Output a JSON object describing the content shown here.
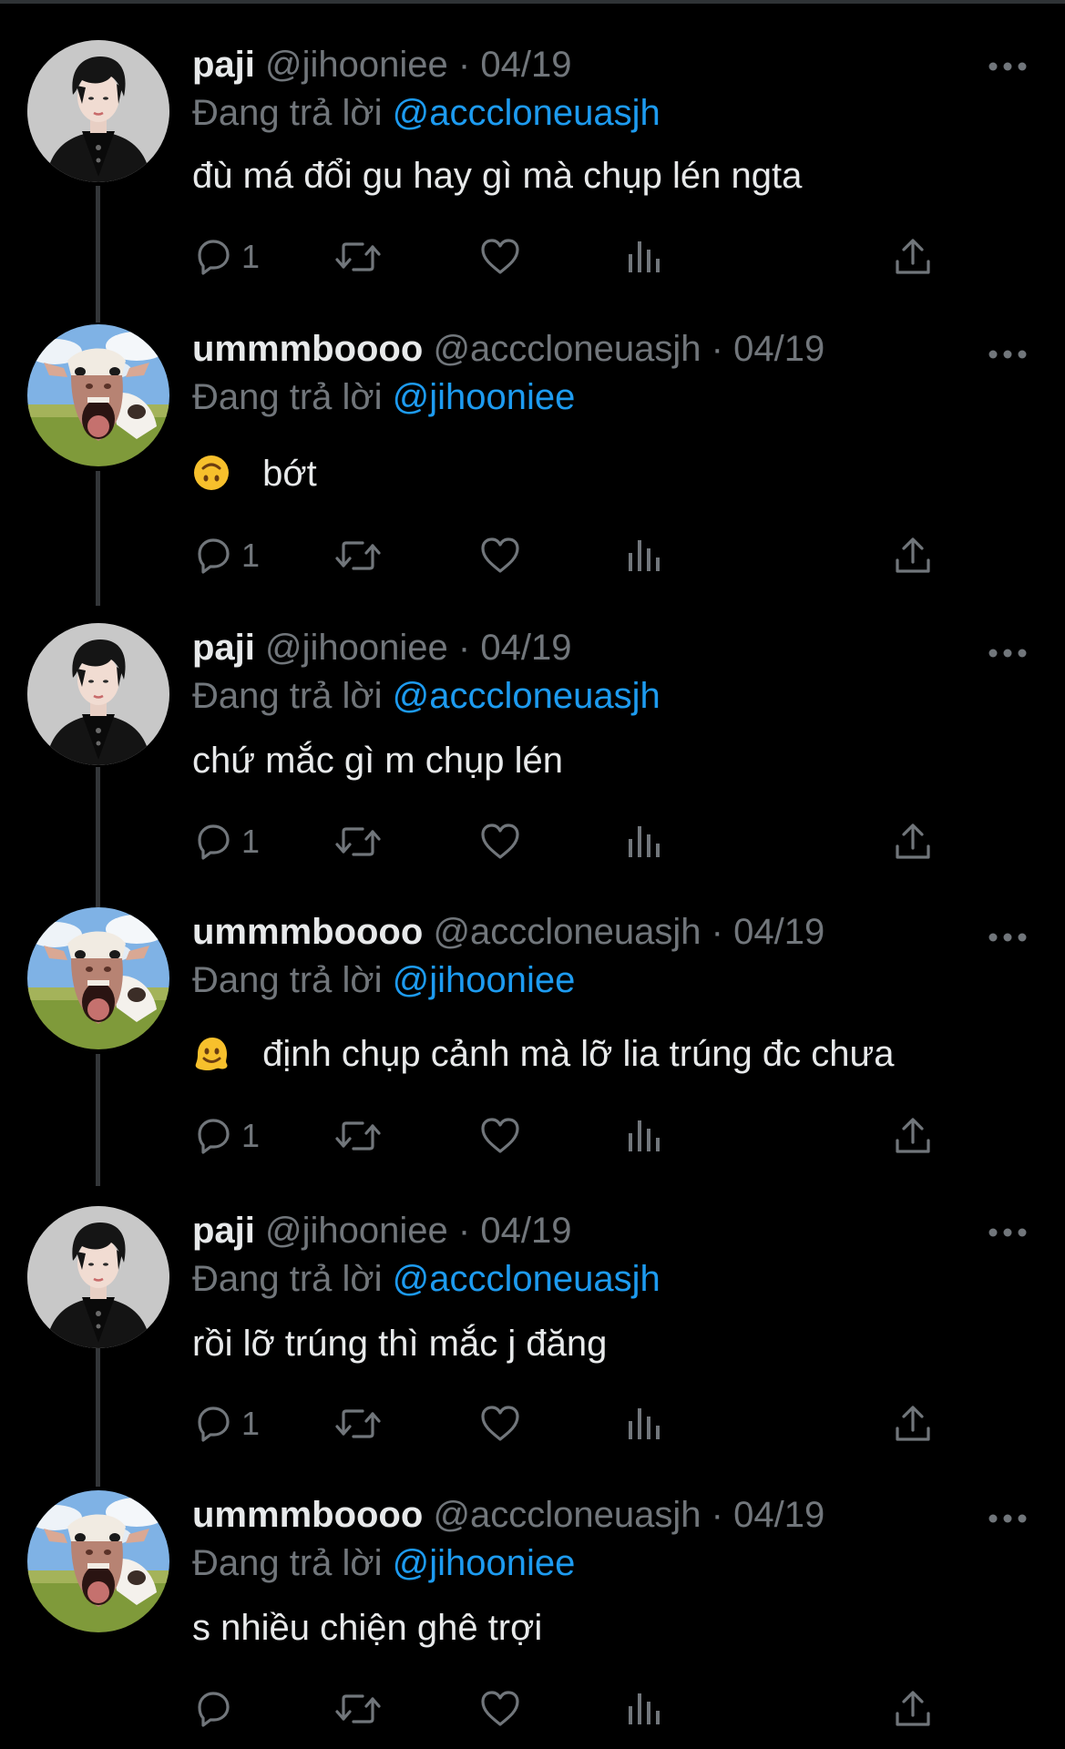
{
  "replying_prefix": "Đang trả lời",
  "users": {
    "paji": {
      "display_name": "paji",
      "handle": "@jihooniee",
      "avatar": "profile-photo-man-black-hair"
    },
    "ummm": {
      "display_name": "ummmboooo",
      "handle": "@acccloneuasjh",
      "avatar": "profile-photo-cow"
    }
  },
  "tweets": [
    {
      "display_name": "paji",
      "handle": "@jihooniee",
      "separator": "·",
      "date": "04/19",
      "replying_prefix": "Đang trả lời",
      "replying_to": "@acccloneuasjh",
      "emoji": "",
      "text": "đù má đổi gu hay gì mà chụp lén ngta",
      "reply_count": "1"
    },
    {
      "display_name": "ummmboooo",
      "handle": "@acccloneuasjh",
      "separator": "·",
      "date": "04/19",
      "replying_prefix": "Đang trả lời",
      "replying_to": "@jihooniee",
      "emoji": "upside-down-face",
      "text": "bớt",
      "reply_count": "1"
    },
    {
      "display_name": "paji",
      "handle": "@jihooniee",
      "separator": "·",
      "date": "04/19",
      "replying_prefix": "Đang trả lời",
      "replying_to": "@acccloneuasjh",
      "emoji": "",
      "text": "chứ mắc gì m chụp lén",
      "reply_count": "1"
    },
    {
      "display_name": "ummmboooo",
      "handle": "@acccloneuasjh",
      "separator": "·",
      "date": "04/19",
      "replying_prefix": "Đang trả lời",
      "replying_to": "@jihooniee",
      "emoji": "melting-face",
      "text": "định chụp cảnh mà lỡ lia trúng đc chưa",
      "reply_count": "1"
    },
    {
      "display_name": "paji",
      "handle": "@jihooniee",
      "separator": "·",
      "date": "04/19",
      "replying_prefix": "Đang trả lời",
      "replying_to": "@acccloneuasjh",
      "emoji": "",
      "text": "rồi lỡ trúng thì mắc j đăng",
      "reply_count": "1"
    },
    {
      "display_name": "ummmboooo",
      "handle": "@acccloneuasjh",
      "separator": "·",
      "date": "04/19",
      "replying_prefix": "Đang trả lời",
      "replying_to": "@jihooniee",
      "emoji": "",
      "text": "s nhiều chiện ghê trợi",
      "reply_count": ""
    }
  ],
  "icons": {
    "reply": "reply-bubble-icon",
    "retweet": "retweet-icon",
    "like": "heart-icon",
    "views": "bar-chart-icon",
    "share": "share-upload-icon",
    "more": "more-horizontal-icon"
  },
  "colors": {
    "background": "#000000",
    "text_primary": "#e7e9ea",
    "text_secondary": "#71767b",
    "link": "#1d9bf0",
    "thread_line": "#333639"
  }
}
